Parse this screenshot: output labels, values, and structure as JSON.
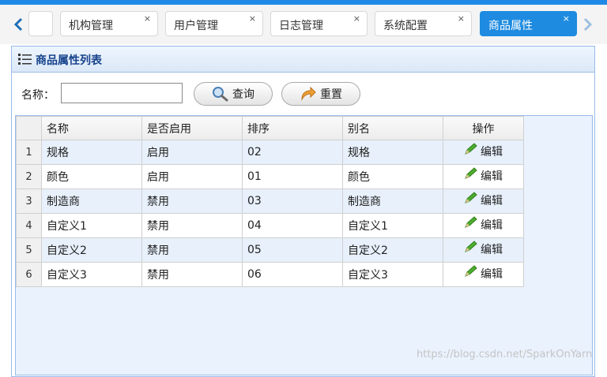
{
  "tabs": [
    {
      "label": "",
      "close": ""
    },
    {
      "label": "机构管理",
      "close": "×"
    },
    {
      "label": "用户管理",
      "close": "×"
    },
    {
      "label": "日志管理",
      "close": "×"
    },
    {
      "label": "系统配置",
      "close": "×"
    },
    {
      "label": "商品属性",
      "close": "×"
    }
  ],
  "panel": {
    "title": "商品属性列表"
  },
  "search": {
    "name_label": "名称：",
    "name_value": "",
    "query_label": "查询",
    "reset_label": "重置"
  },
  "table": {
    "headers": [
      "名称",
      "是否启用",
      "排序",
      "别名",
      "操作"
    ],
    "rows": [
      {
        "num": "1",
        "name": "规格",
        "enabled": "启用",
        "order": "02",
        "alias": "规格",
        "action": "编辑"
      },
      {
        "num": "2",
        "name": "颜色",
        "enabled": "启用",
        "order": "01",
        "alias": "颜色",
        "action": "编辑"
      },
      {
        "num": "3",
        "name": "制造商",
        "enabled": "禁用",
        "order": "03",
        "alias": "制造商",
        "action": "编辑"
      },
      {
        "num": "4",
        "name": "自定义1",
        "enabled": "禁用",
        "order": "04",
        "alias": "自定义1",
        "action": "编辑"
      },
      {
        "num": "5",
        "name": "自定义2",
        "enabled": "禁用",
        "order": "05",
        "alias": "自定义2",
        "action": "编辑"
      },
      {
        "num": "6",
        "name": "自定义3",
        "enabled": "禁用",
        "order": "06",
        "alias": "自定义3",
        "action": "编辑"
      }
    ]
  },
  "watermark": "https://blog.csdn.net/SparkOnYarn",
  "colors": {
    "accent": "#1e8be0",
    "header_text": "#15428b",
    "border": "#99bbe8"
  }
}
